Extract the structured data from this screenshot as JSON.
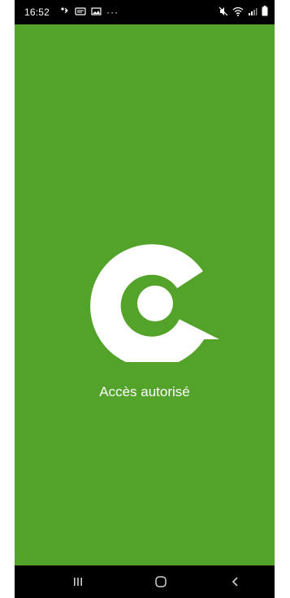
{
  "status_bar": {
    "time": "16:52",
    "notification_icons": [
      "bluetooth-audio-icon",
      "message-icon",
      "image-icon"
    ],
    "more_indicator": "···",
    "system_icons": [
      "mute-icon",
      "wifi-icon",
      "signal-icon",
      "battery-icon"
    ]
  },
  "main": {
    "background_color": "#53a229",
    "logo": "circle-search-logo",
    "status_text": "Accès autorisé"
  },
  "nav_bar": {
    "buttons": [
      "recent-apps",
      "home",
      "back"
    ]
  }
}
